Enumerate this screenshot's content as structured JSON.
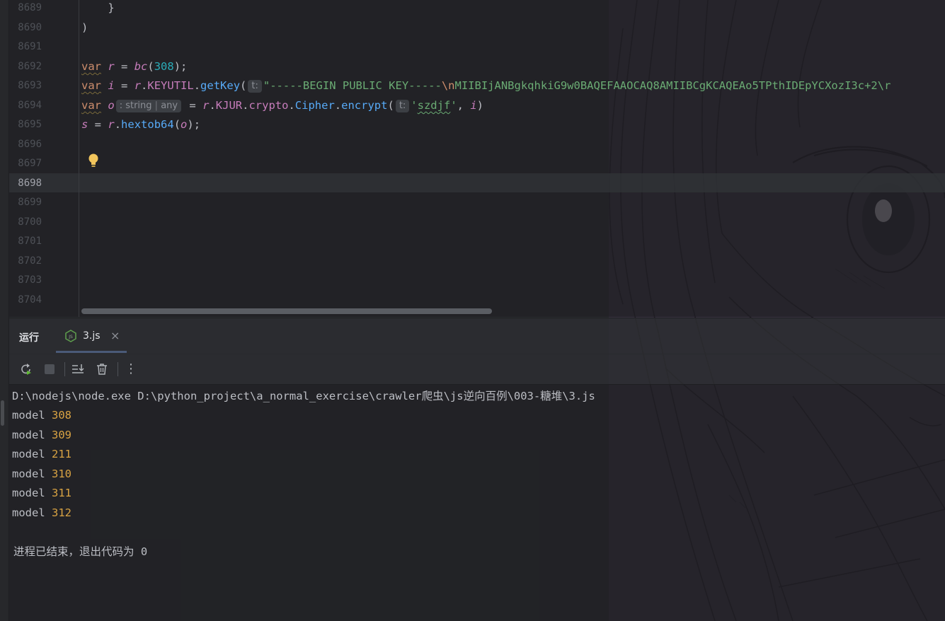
{
  "editor": {
    "line_numbers": [
      "8689",
      "8690",
      "8691",
      "8692",
      "8693",
      "8694",
      "8695",
      "8696",
      "8697",
      "8698",
      "8699",
      "8700",
      "8701",
      "8702",
      "8703",
      "8704"
    ],
    "active_line": "8698",
    "lines": {
      "l8689": "    }",
      "l8690": ")",
      "l8692": {
        "kw": "var",
        "name": "r",
        "eq": " = ",
        "call": "bc",
        "open": "(",
        "num": "308",
        "close": ");"
      },
      "l8693": {
        "kw": "var",
        "name": "i",
        "eq": " = ",
        "obj": "r",
        "dot1": ".",
        "prop": "KEYUTIL",
        "dot2": ".",
        "fn": "getKey",
        "open": "(",
        "hint": "t:",
        "str": "\"-----BEGIN PUBLIC KEY-----",
        "esc": "\\n",
        "str2": "MIIBIjANBgkqhkiG9w0BAQEFAAOCAQ8AMIIBCgKCAQEAo5TPthIDEpYCXozI3c+2\\r"
      },
      "l8694": {
        "kw": "var",
        "name": "o",
        "hint_type": ": string",
        "hint_sep": " | ",
        "hint_any": "any",
        "eq": " = ",
        "obj": "r",
        "dot1": ".",
        "p1": "KJUR",
        "dot2": ".",
        "p2": "crypto",
        "dot3": ".",
        "p3": "Cipher",
        "dot4": ".",
        "fn": "encrypt",
        "open": "(",
        "hint": "t:",
        "q1": "'",
        "str": "szdjf",
        "q2": "'",
        "comma": ", ",
        "arg": "i",
        "close": ")"
      },
      "l8695": {
        "name": "s",
        "eq": " = ",
        "obj": "r",
        "dot": ".",
        "fn": "hextob64",
        "open": "(",
        "arg": "o",
        "close": ");"
      }
    }
  },
  "run_panel": {
    "title": "运行",
    "tab_label": "3.js",
    "tab_close": "×",
    "tab_icon_text": "JS"
  },
  "toolbar": {
    "more": "⋮"
  },
  "console": {
    "command": "D:\\nodejs\\node.exe D:\\python_project\\a_normal_exercise\\crawler爬虫\\js逆向百例\\003-糖堆\\3.js",
    "outputs": [
      {
        "label": "model ",
        "value": "308"
      },
      {
        "label": "model ",
        "value": "309"
      },
      {
        "label": "model ",
        "value": "211"
      },
      {
        "label": "model ",
        "value": "310"
      },
      {
        "label": "model ",
        "value": "311"
      },
      {
        "label": "model ",
        "value": "312"
      }
    ],
    "exit_message": "进程已结束，退出代码为 0"
  },
  "colors": {
    "keyword": "#cf8e6d",
    "variable": "#c77dbb",
    "function": "#57aaf7",
    "number": "#2aacb8",
    "string": "#6aab73",
    "console_number": "#d9a343"
  }
}
